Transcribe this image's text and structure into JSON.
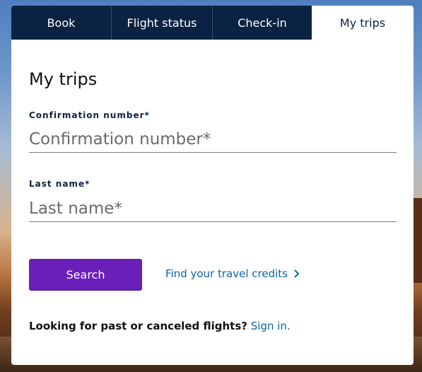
{
  "tabs": [
    {
      "label": "Book"
    },
    {
      "label": "Flight status"
    },
    {
      "label": "Check-in"
    },
    {
      "label": "My trips",
      "active": true
    }
  ],
  "page_title": "My trips",
  "confirmation": {
    "label": "Confirmation number*",
    "placeholder": "Confirmation number*",
    "value": ""
  },
  "last_name": {
    "label": "Last name*",
    "placeholder": "Last name*",
    "value": ""
  },
  "search_button": "Search",
  "credits_link": "Find your travel credits",
  "past_flights": {
    "text": "Looking for past or canceled flights?",
    "link": "Sign in."
  },
  "colors": {
    "tab_bar": "#0b2343",
    "primary_button": "#6a1fb8",
    "link": "#0a66a8"
  },
  "icons": [
    "chevron-right-icon"
  ]
}
